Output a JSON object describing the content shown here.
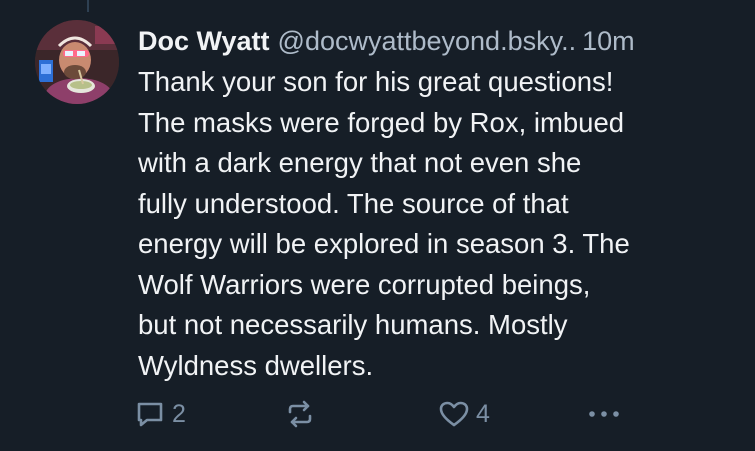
{
  "post": {
    "author": {
      "display_name": "Doc Wyatt",
      "handle": "@docwyattbeyond.bsky..",
      "avatar": "avatar-photo"
    },
    "timestamp": "10m",
    "text": "Thank your son for his great questions! The masks were forged by Rox, imbued with a dark energy that not even she fully understood. The source of that energy will be explored in season 3. The Wolf Warriors were corrupted beings, but not necessarily humans. Mostly Wyldness dwellers.",
    "text_lines": [
      "Thank your son for his great questions!",
      "The masks were forged by Rox, imbued",
      "with a dark energy that not even she",
      "fully understood. The source of that",
      "energy will be explored in season 3. The",
      "Wolf Warriors were corrupted beings,",
      "but not necessarily humans. Mostly",
      "Wyldness dwellers."
    ],
    "actions": {
      "reply": {
        "icon": "reply-bubble-icon",
        "count": "2"
      },
      "repost": {
        "icon": "repost-icon"
      },
      "like": {
        "icon": "heart-icon",
        "count": "4"
      },
      "more": {
        "icon": "more-dots-icon"
      }
    }
  },
  "colors": {
    "background": "#161e27",
    "text_primary": "#f1f3f5",
    "text_secondary": "#aebbc9",
    "icon_muted": "#7b8fa4"
  }
}
